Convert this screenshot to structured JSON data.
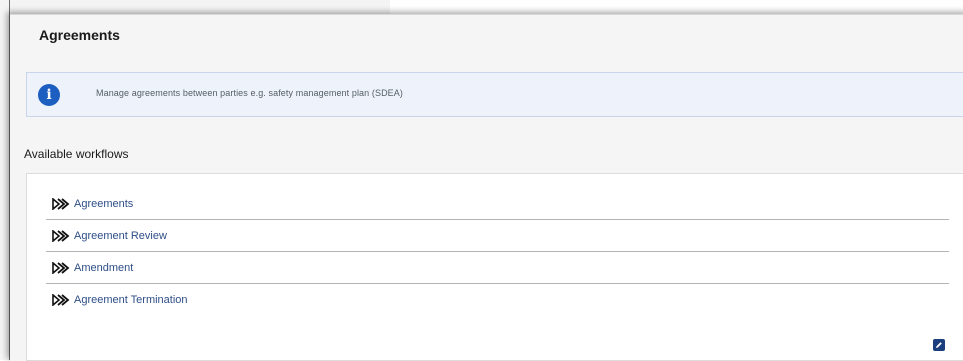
{
  "panel": {
    "title": "Agreements"
  },
  "info": {
    "icon": "info-icon",
    "text": "Manage agreements between parties e.g. safety management plan (SDEA)",
    "accent": "#1c5fc0"
  },
  "workflows": {
    "heading": "Available workflows",
    "items": [
      {
        "label": "Agreements",
        "icon": "double-chevron-icon"
      },
      {
        "label": "Agreement Review",
        "icon": "double-chevron-icon"
      },
      {
        "label": "Amendment",
        "icon": "double-chevron-icon"
      },
      {
        "label": "Agreement Termination",
        "icon": "double-chevron-icon"
      }
    ],
    "edit_icon": "edit-icon"
  }
}
